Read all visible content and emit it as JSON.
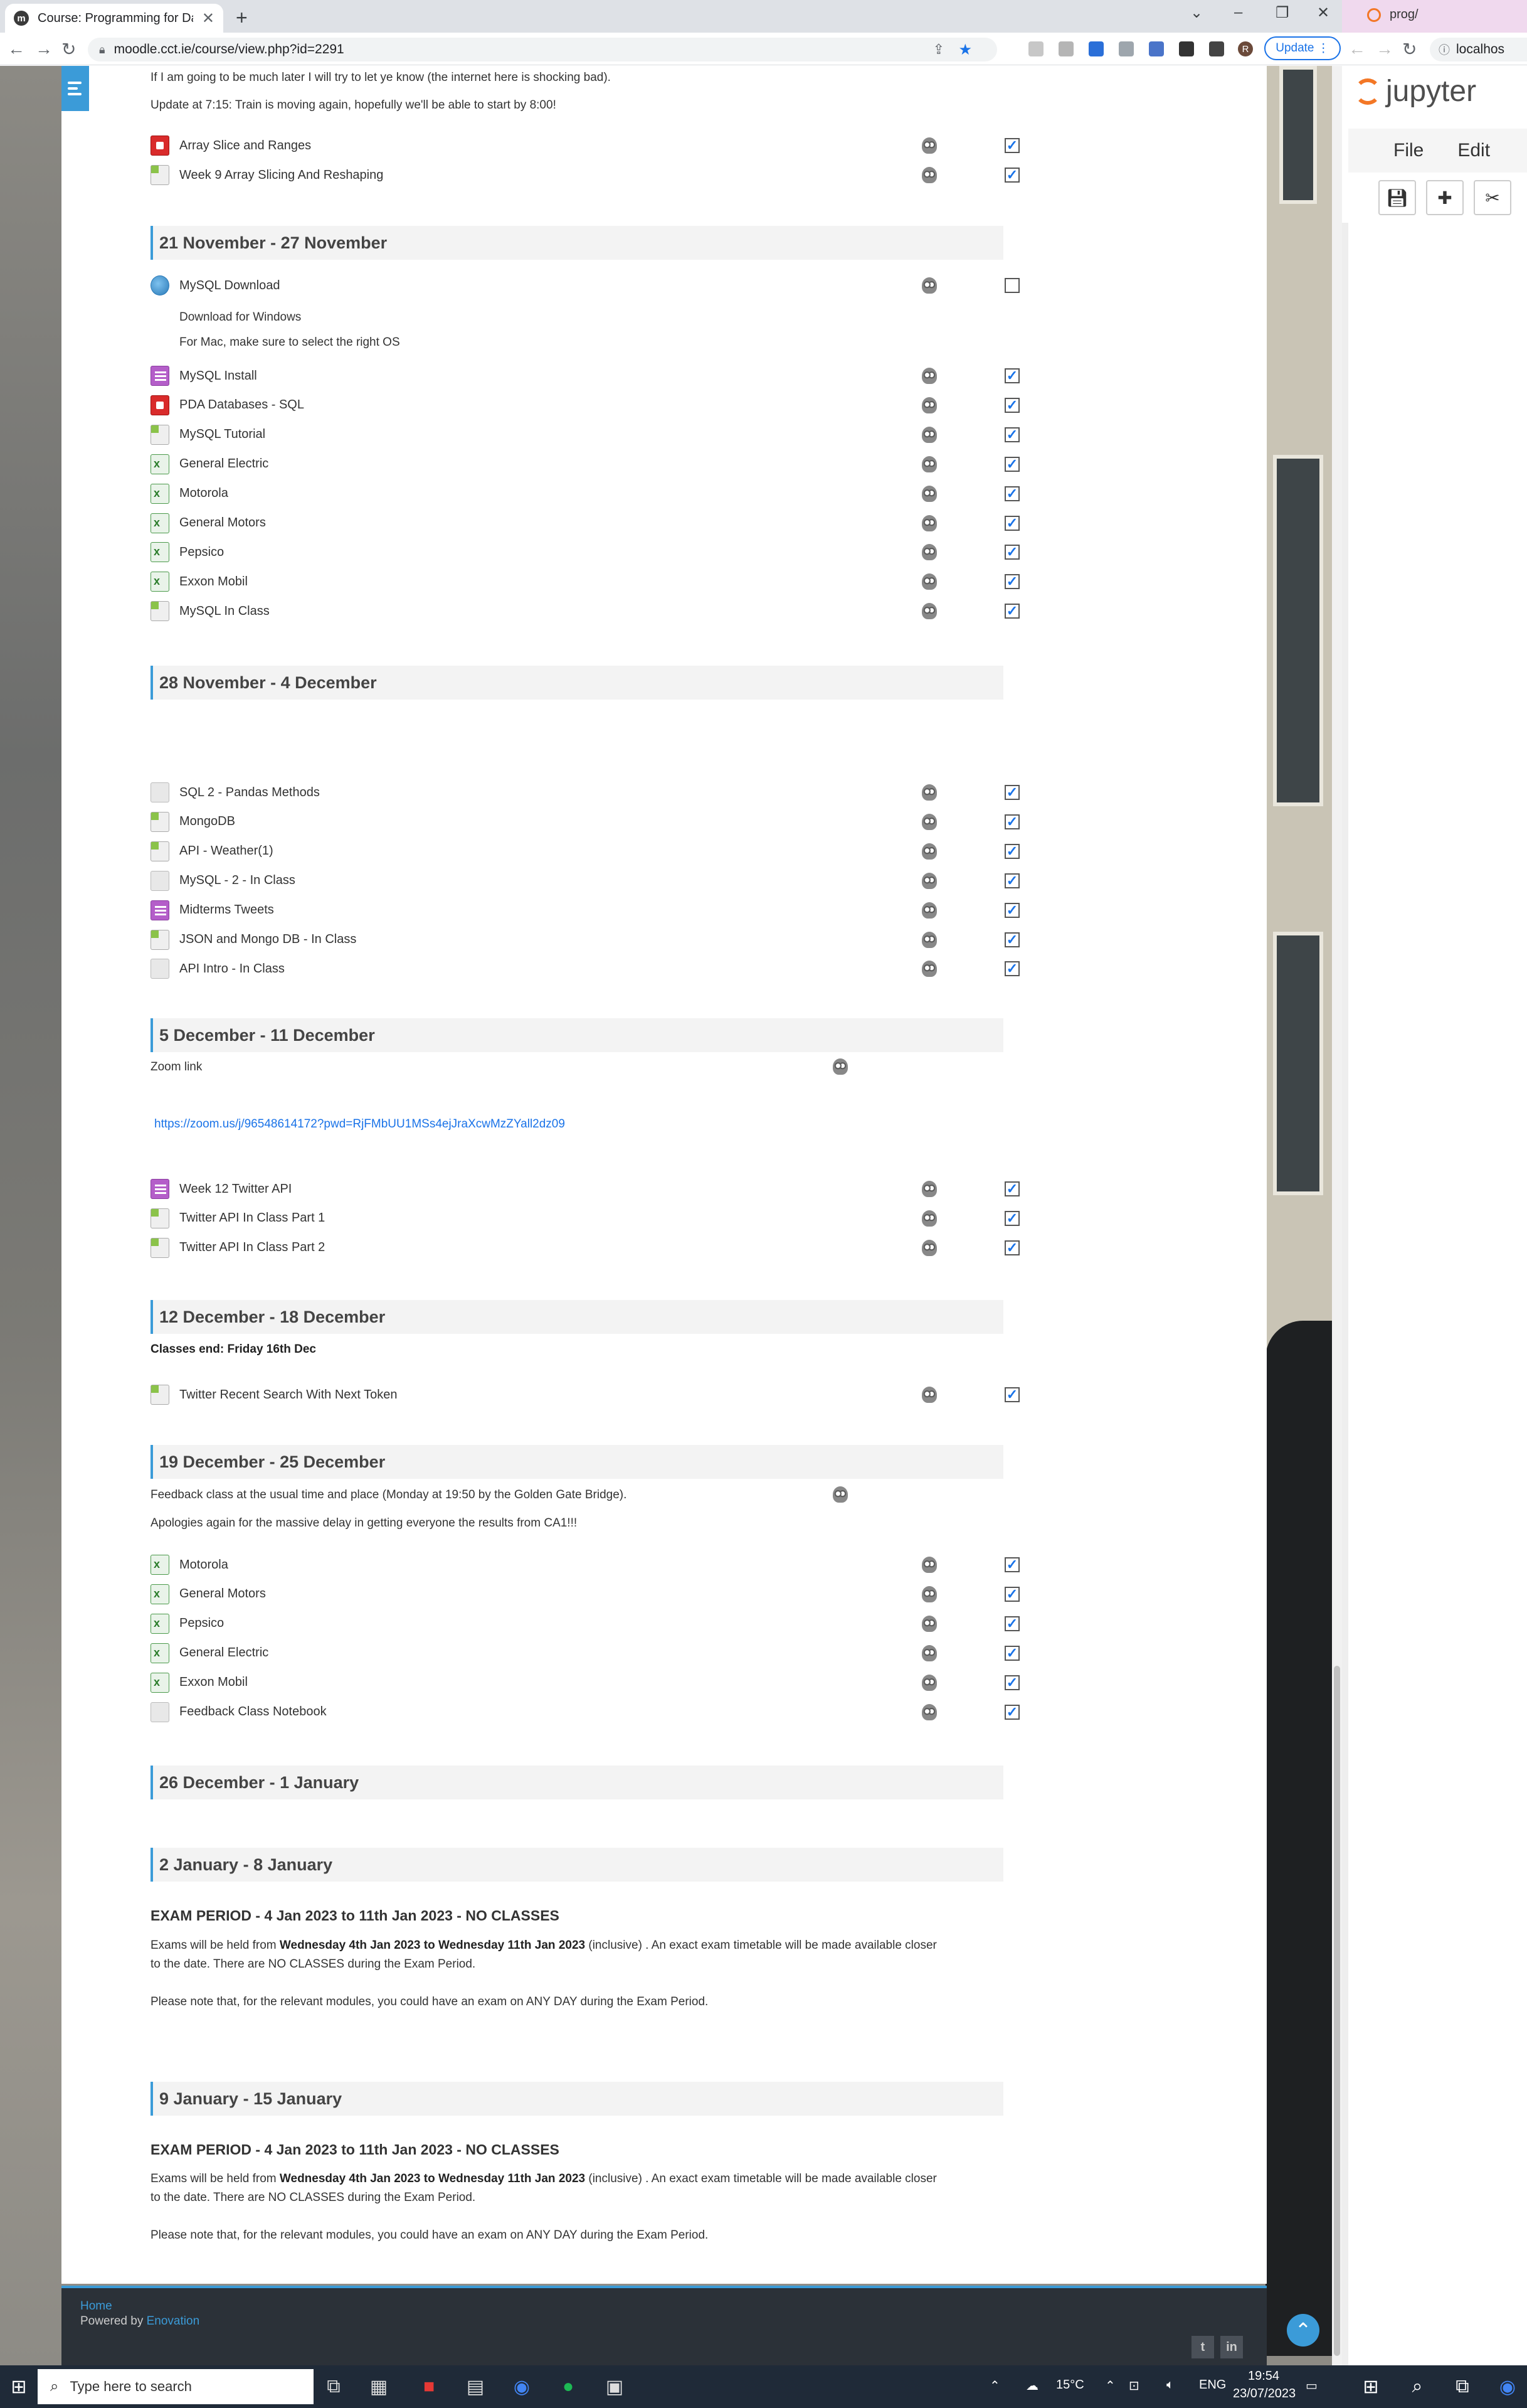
{
  "browser": {
    "tab_title": "Course: Programming for Data A",
    "url": "moodle.cct.ie/course/view.php?id=2291",
    "update_label": "Update"
  },
  "top_text": {
    "line1": "If I am going to be much later I will try to let ye know (the internet here is shocking bad).",
    "line2": "Update at 7:15: Train is moving again, hopefully we'll be able to start by 8:00!"
  },
  "week0": {
    "items": [
      {
        "name": "Array Slice and Ranges",
        "icon": "pdf-icon",
        "checked": true
      },
      {
        "name": "Week 9 Array Slicing And Reshaping",
        "icon": "notebook-icon",
        "checked": true
      }
    ]
  },
  "week1": {
    "title": "21 November - 27 November",
    "download_name": "MySQL Download",
    "download_checked": false,
    "download_note1": "Download for Windows",
    "download_note2": "For Mac, make sure to select the right OS",
    "items": [
      {
        "name": "MySQL Install",
        "icon": "document-icon",
        "checked": true
      },
      {
        "name": "PDA Databases - SQL",
        "icon": "pdf-icon",
        "checked": true
      },
      {
        "name": "MySQL Tutorial",
        "icon": "notebook-icon",
        "checked": true
      },
      {
        "name": "General Electric",
        "icon": "spreadsheet-icon",
        "checked": true
      },
      {
        "name": "Motorola",
        "icon": "spreadsheet-icon",
        "checked": true
      },
      {
        "name": "General Motors",
        "icon": "spreadsheet-icon",
        "checked": true
      },
      {
        "name": "Pepsico",
        "icon": "spreadsheet-icon",
        "checked": true
      },
      {
        "name": "Exxon Mobil",
        "icon": "spreadsheet-icon",
        "checked": true
      },
      {
        "name": "MySQL In Class",
        "icon": "notebook-icon",
        "checked": true
      }
    ]
  },
  "week2": {
    "title": "28 November - 4 December",
    "items": [
      {
        "name": "SQL 2 - Pandas Methods",
        "icon": "file-icon",
        "checked": true
      },
      {
        "name": "MongoDB",
        "icon": "notebook-icon",
        "checked": true
      },
      {
        "name": "API - Weather(1)",
        "icon": "notebook-icon",
        "checked": true
      },
      {
        "name": "MySQL - 2 - In Class",
        "icon": "file-icon",
        "checked": true
      },
      {
        "name": "Midterms Tweets",
        "icon": "document-icon",
        "checked": true
      },
      {
        "name": "JSON and Mongo DB - In Class",
        "icon": "notebook-icon",
        "checked": true
      },
      {
        "name": "API Intro - In Class",
        "icon": "file-icon",
        "checked": true
      }
    ]
  },
  "week3": {
    "title": "5 December - 11 December",
    "zoom_label": "Zoom link",
    "zoom_url": "https://zoom.us/j/96548614172?pwd=RjFMbUU1MSs4ejJraXcwMzZYall2dz09",
    "items": [
      {
        "name": "Week 12 Twitter API",
        "icon": "document-icon",
        "checked": true
      },
      {
        "name": "Twitter API In Class Part 1",
        "icon": "notebook-icon",
        "checked": true
      },
      {
        "name": "Twitter API In Class Part 2",
        "icon": "notebook-icon",
        "checked": true
      }
    ]
  },
  "week4": {
    "title": "12 December - 18 December",
    "note": "Classes end: Friday 16th Dec",
    "items": [
      {
        "name": "Twitter Recent Search With Next Token",
        "icon": "notebook-icon",
        "checked": true
      }
    ]
  },
  "week5": {
    "title": "19 December - 25 December",
    "note1": "Feedback class at the usual time and place (Monday at 19:50 by the Golden Gate Bridge).",
    "note2": "Apologies again for the massive delay in getting everyone the results from CA1!!!",
    "items": [
      {
        "name": "Motorola",
        "icon": "spreadsheet-icon",
        "checked": true
      },
      {
        "name": "General Motors",
        "icon": "spreadsheet-icon",
        "checked": true
      },
      {
        "name": "Pepsico",
        "icon": "spreadsheet-icon",
        "checked": true
      },
      {
        "name": "General Electric",
        "icon": "spreadsheet-icon",
        "checked": true
      },
      {
        "name": "Exxon Mobil",
        "icon": "spreadsheet-icon",
        "checked": true
      },
      {
        "name": "Feedback Class Notebook",
        "icon": "file-icon",
        "checked": true
      }
    ]
  },
  "week6": {
    "title": "26 December - 1 January"
  },
  "week7": {
    "title": "2 January - 8 January",
    "heading": "EXAM PERIOD - 4 Jan 2023 to 11th Jan 2023 - NO CLASSES",
    "p1_pre": "Exams will be held from ",
    "p1_bold": "Wednesday 4th Jan 2023 to Wednesday 11th Jan 2023",
    "p1_post": " (inclusive) . An exact exam timetable will be made available closer",
    "p1_line2": "to the date. There are NO CLASSES during the Exam Period.",
    "p2": "Please note that, for the relevant modules, you could have an exam on ANY DAY during the Exam Period."
  },
  "week8": {
    "title": "9 January - 15 January",
    "heading": "EXAM PERIOD - 4 Jan 2023 to 11th Jan 2023 - NO CLASSES",
    "p1_pre": "Exams will be held from ",
    "p1_bold": "Wednesday 4th Jan 2023 to Wednesday 11th Jan 2023",
    "p1_post": " (inclusive) . An exact exam timetable will be made available closer",
    "p1_line2": "to the date. There are NO CLASSES during the Exam Period.",
    "p2": "Please note that, for the relevant modules, you could have an exam on ANY DAY during the Exam Period."
  },
  "footer": {
    "home": "Home",
    "powered_by": "Powered by ",
    "brand": "Enovation"
  },
  "right_window": {
    "tab_title": "prog/",
    "url": "localhos",
    "app_name": "jupyter",
    "menu": [
      "File",
      "Edit"
    ]
  },
  "taskbar": {
    "search_placeholder": "Type here to search",
    "weather": "15°C",
    "lang": "ENG",
    "time": "19:54",
    "date": "23/07/2023"
  },
  "colors": {
    "accent": "#3b9bd8",
    "link": "#1a73e8",
    "footer_bg": "#2b3138",
    "jupyter_orange": "#f37726"
  }
}
